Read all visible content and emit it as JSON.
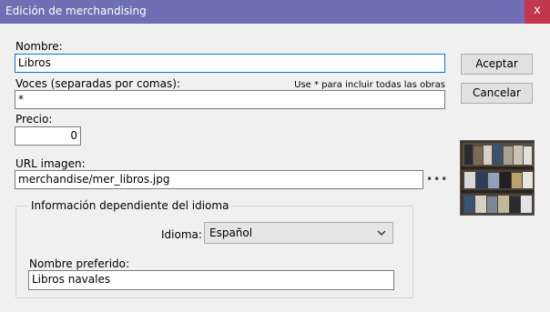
{
  "window": {
    "title": "Edición de merchandising",
    "close_glyph": "x"
  },
  "form": {
    "name_label": "Nombre:",
    "name_value": "Libros",
    "voices_label": "Voces (separadas por comas):",
    "voices_hint": "Use * para incluir todas las obras",
    "voices_value": "*",
    "price_label": "Precio:",
    "price_value": "0",
    "image_url_label": "URL imagen:",
    "image_url_value": "merchandise/mer_libros.jpg",
    "browse_glyph": "•••"
  },
  "language_group": {
    "title": "Información dependiente del idioma",
    "language_label": "Idioma:",
    "language_value": "Español",
    "preferred_name_label": "Nombre preferido:",
    "preferred_name_value": "Libros navales"
  },
  "buttons": {
    "accept": "Aceptar",
    "cancel": "Cancelar"
  },
  "icons": {
    "close": "close-icon",
    "dropdown": "chevron-down-icon",
    "browse": "more-icon"
  },
  "colors": {
    "titlebar": "#6f6fb3",
    "close": "#c2374a",
    "focus": "#0078d7"
  }
}
